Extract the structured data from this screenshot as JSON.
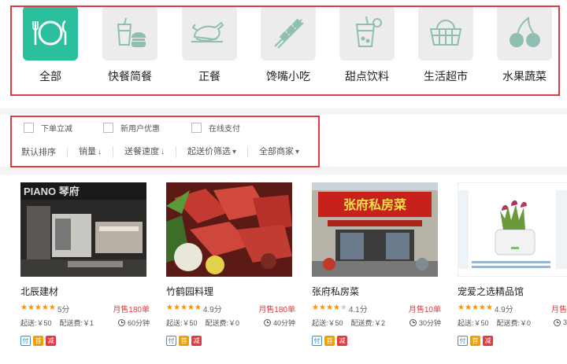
{
  "categories": [
    {
      "label": "全部",
      "icon": "plate-cutlery-icon",
      "active": true
    },
    {
      "label": "快餐简餐",
      "icon": "fastfood-icon",
      "active": false
    },
    {
      "label": "正餐",
      "icon": "roast-chicken-icon",
      "active": false
    },
    {
      "label": "馋嘴小吃",
      "icon": "skewer-icon",
      "active": false
    },
    {
      "label": "甜点饮料",
      "icon": "drink-icon",
      "active": false
    },
    {
      "label": "生活超市",
      "icon": "basket-icon",
      "active": false
    },
    {
      "label": "水果蔬菜",
      "icon": "cherry-icon",
      "active": false
    }
  ],
  "filters": {
    "checkboxes": [
      "下单立减",
      "新用户优惠",
      "在线支付"
    ],
    "sorts": [
      {
        "label": "默认排序",
        "arrow": ""
      },
      {
        "label": "销量",
        "arrow": "↓"
      },
      {
        "label": "送餐速度",
        "arrow": "↓"
      },
      {
        "label": "起送价筛选",
        "arrow": "▾"
      },
      {
        "label": "全部商家",
        "arrow": "▾"
      }
    ]
  },
  "shops": [
    {
      "name": "北辰建材",
      "rating": 5,
      "score": "5分",
      "sold": "月售180单",
      "min": "起送:￥50",
      "fee": "配送费:￥1",
      "time": "60分钟",
      "tags": [
        "付",
        "首",
        "减"
      ],
      "image_text": "PIANO 琴府"
    },
    {
      "name": "竹鹤园料理",
      "rating": 5,
      "score": "4.9分",
      "sold": "月售180单",
      "min": "起送:￥50",
      "fee": "配送费:￥0",
      "time": "40分钟",
      "tags": [
        "付",
        "首",
        "减"
      ],
      "image_text": ""
    },
    {
      "name": "张府私房菜",
      "rating": 4,
      "score": "4.1分",
      "sold": "月售10单",
      "min": "起送:￥50",
      "fee": "配送费:￥2",
      "time": "30分钟",
      "tags": [
        "付",
        "首",
        "减"
      ],
      "image_text": "张府私房菜"
    },
    {
      "name": "宠爱之选精品馆",
      "rating": 5,
      "score": "4.9分",
      "sold": "月售",
      "min": "起送:￥50",
      "fee": "配送费:￥0",
      "time": "3",
      "tags": [
        "付",
        "首",
        "减"
      ],
      "image_text": ""
    }
  ],
  "colors": {
    "accent": "#2cbf9d",
    "highlight_border": "#e03c41",
    "star": "#ff9000"
  }
}
